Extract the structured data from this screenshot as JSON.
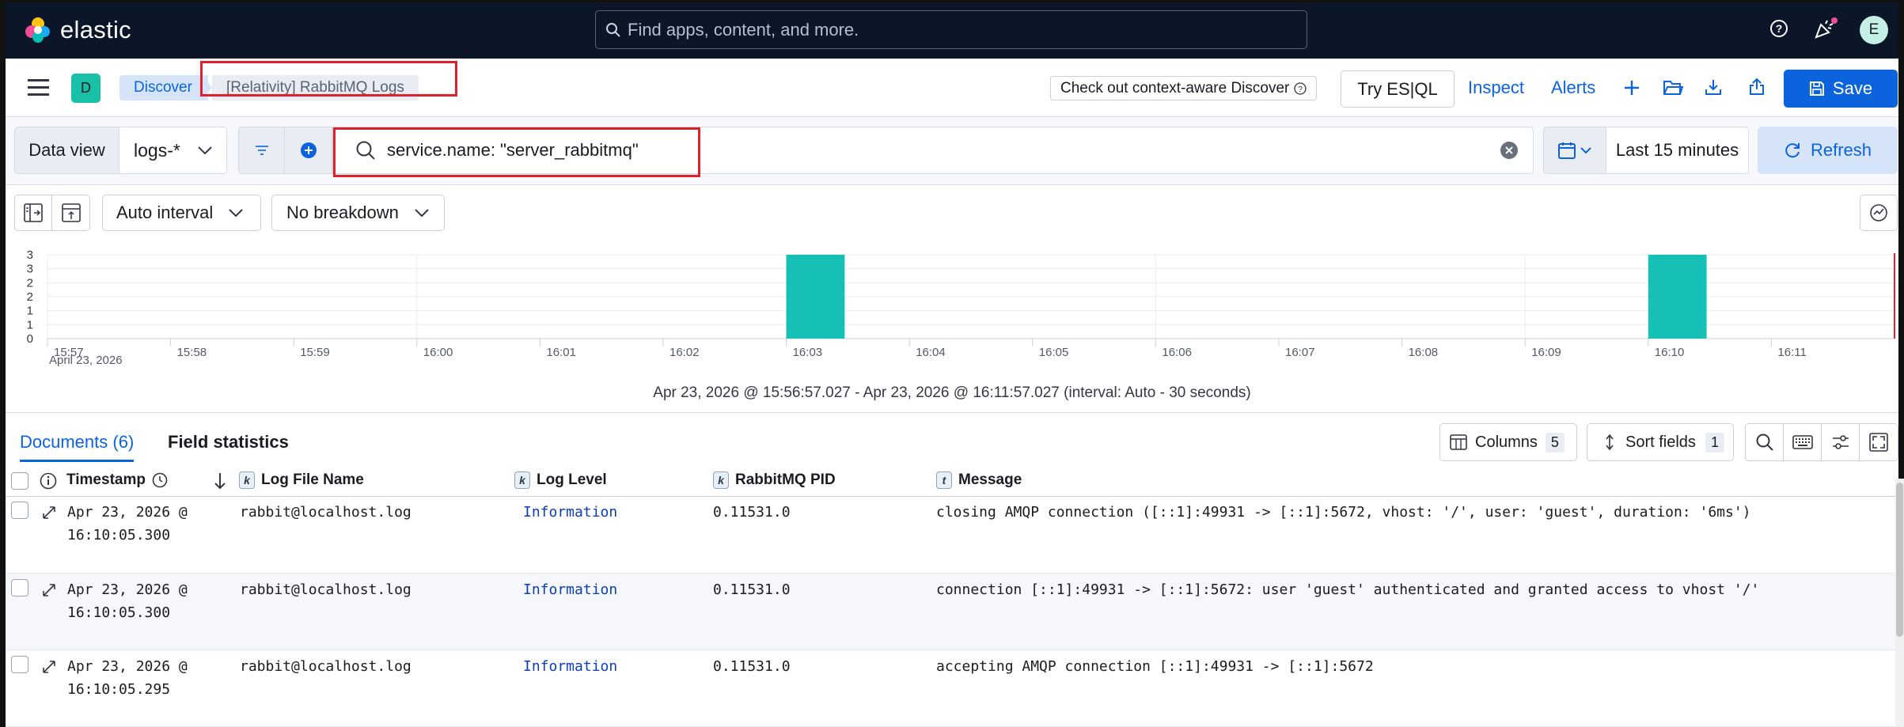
{
  "topbar": {
    "logo_text": "elastic",
    "search_placeholder": "Find apps, content, and more.",
    "avatar_initial": "E"
  },
  "appbar": {
    "app_badge": "D",
    "breadcrumb_discover": "Discover",
    "breadcrumb_current": "[Relativity] RabbitMQ Logs",
    "context_aware_label": "Check out context-aware Discover",
    "try_esql_label": "Try ES|QL",
    "inspect_label": "Inspect",
    "alerts_label": "Alerts",
    "save_label": "Save"
  },
  "querybar": {
    "data_view_label": "Data view",
    "data_view_value": "logs-*",
    "query": "service.name: \"server_rabbitmq\"",
    "date_range": "Last 15 minutes",
    "refresh_label": "Refresh"
  },
  "chart_toolbar": {
    "interval": "Auto interval",
    "breakdown": "No breakdown"
  },
  "chart_data": {
    "type": "bar",
    "categories": [
      "15:57",
      "15:58",
      "15:59",
      "16:00",
      "16:01",
      "16:02",
      "16:03",
      "16:04",
      "16:05",
      "16:06",
      "16:07",
      "16:08",
      "16:09",
      "16:10",
      "16:11"
    ],
    "date_label": "April 23, 2026",
    "y_ticks": [
      "3",
      "3",
      "2",
      "2",
      "1",
      "1",
      "0"
    ],
    "ylim": [
      0,
      3
    ],
    "bars": [
      {
        "x": "16:03:00",
        "value": 3
      },
      {
        "x": "16:10:00",
        "value": 3
      }
    ],
    "grid": true,
    "color": "#17c0b6",
    "time_range_label": "Apr 23, 2026 @ 15:56:57.027 - Apr 23, 2026 @ 16:11:57.027 (interval: Auto - 30 seconds)"
  },
  "tabs": {
    "documents": "Documents (6)",
    "field_statistics": "Field statistics"
  },
  "grid_toolbar": {
    "columns_label": "Columns",
    "columns_count": "5",
    "sort_label": "Sort fields",
    "sort_count": "1"
  },
  "table": {
    "headers": [
      {
        "label": "Timestamp",
        "type": ""
      },
      {
        "label": "Log File Name",
        "type": "k"
      },
      {
        "label": "Log Level",
        "type": "k"
      },
      {
        "label": "RabbitMQ PID",
        "type": "k"
      },
      {
        "label": "Message",
        "type": "t"
      }
    ],
    "rows": [
      {
        "ts1": "Apr 23, 2026 @",
        "ts2": "16:10:05.300",
        "file": "rabbit@localhost.log",
        "level": "Information",
        "pid": "0.11531.0",
        "message": "closing AMQP connection ([::1]:49931 -> [::1]:5672, vhost: '/', user: 'guest', duration: '6ms')"
      },
      {
        "ts1": "Apr 23, 2026 @",
        "ts2": "16:10:05.300",
        "file": "rabbit@localhost.log",
        "level": "Information",
        "pid": "0.11531.0",
        "message": "connection [::1]:49931 -> [::1]:5672: user 'guest' authenticated and granted access to vhost '/'"
      },
      {
        "ts1": "Apr 23, 2026 @",
        "ts2": "16:10:05.295",
        "file": "rabbit@localhost.log",
        "level": "Information",
        "pid": "0.11531.0",
        "message": "accepting AMQP connection [::1]:49931 -> [::1]:5672"
      }
    ]
  }
}
